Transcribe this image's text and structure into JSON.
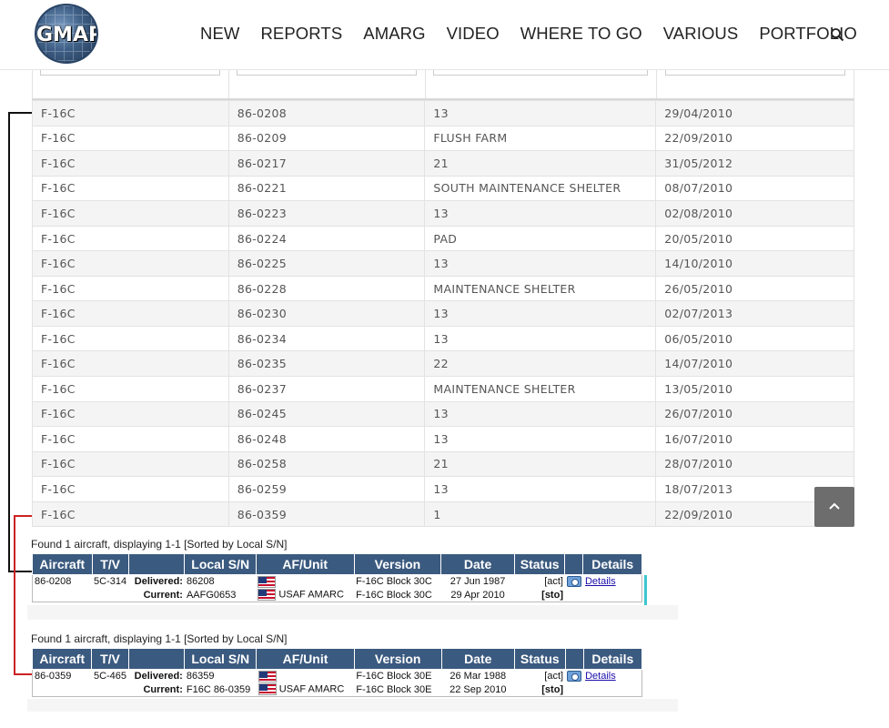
{
  "header": {
    "logo_text": "GMAP",
    "nav": [
      "NEW",
      "REPORTS",
      "AMARG",
      "VIDEO",
      "WHERE TO GO",
      "VARIOUS",
      "PORTFOLIO"
    ]
  },
  "table": {
    "rows": [
      [
        "F-16C",
        "86-0208",
        "13",
        "29/04/2010"
      ],
      [
        "F-16C",
        "86-0209",
        "FLUSH FARM",
        "22/09/2010"
      ],
      [
        "F-16C",
        "86-0217",
        "21",
        "31/05/2012"
      ],
      [
        "F-16C",
        "86-0221",
        "SOUTH MAINTENANCE SHELTER",
        "08/07/2010"
      ],
      [
        "F-16C",
        "86-0223",
        "13",
        "02/08/2010"
      ],
      [
        "F-16C",
        "86-0224",
        "PAD",
        "20/05/2010"
      ],
      [
        "F-16C",
        "86-0225",
        "13",
        "14/10/2010"
      ],
      [
        "F-16C",
        "86-0228",
        "MAINTENANCE SHELTER",
        "26/05/2010"
      ],
      [
        "F-16C",
        "86-0230",
        "13",
        "02/07/2013"
      ],
      [
        "F-16C",
        "86-0234",
        "13",
        "06/05/2010"
      ],
      [
        "F-16C",
        "86-0235",
        "22",
        "14/07/2010"
      ],
      [
        "F-16C",
        "86-0237",
        "MAINTENANCE SHELTER",
        "13/05/2010"
      ],
      [
        "F-16C",
        "86-0245",
        "13",
        "26/07/2010"
      ],
      [
        "F-16C",
        "86-0248",
        "13",
        "16/07/2010"
      ],
      [
        "F-16C",
        "86-0258",
        "21",
        "28/07/2010"
      ],
      [
        "F-16C",
        "86-0259",
        "13",
        "18/07/2013"
      ],
      [
        "F-16C",
        "86-0359",
        "1",
        "22/09/2010"
      ]
    ]
  },
  "panels": [
    {
      "found": "Found 1 aircraft, displaying 1-1 [Sorted by Local S/N]",
      "headers": [
        "Aircraft",
        "T/V",
        "",
        "Local S/N",
        "AF/Unit",
        "Version",
        "Date",
        "Status",
        "",
        "Details"
      ],
      "aircraft": "86-0208",
      "tv": "5C-314",
      "delivered_label": "Delivered:",
      "current_label": "Current:",
      "delivered_local": "86208",
      "current_local": "AAFG0653",
      "current_unit": "USAF AMARC",
      "delivered_version": "F-16C Block 30C",
      "current_version": "F-16C Block 30C",
      "delivered_date": "27 Jun 1987",
      "current_date": "29 Apr 2010",
      "delivered_status": "[act]",
      "current_status": "[sto]",
      "details_link": "Details"
    },
    {
      "found": "Found 1 aircraft, displaying 1-1 [Sorted by Local S/N]",
      "headers": [
        "Aircraft",
        "T/V",
        "",
        "Local S/N",
        "AF/Unit",
        "Version",
        "Date",
        "Status",
        "",
        "Details"
      ],
      "aircraft": "86-0359",
      "tv": "5C-465",
      "delivered_label": "Delivered:",
      "current_label": "Current:",
      "delivered_local": "86359",
      "current_local": "F16C 86-0359",
      "current_unit": "USAF AMARC",
      "delivered_version": "F-16C Block 30E",
      "current_version": "F-16C Block 30E",
      "delivered_date": "26 Mar 1988",
      "current_date": "22 Sep 2010",
      "delivered_status": "[act]",
      "current_status": "[sto]",
      "details_link": "Details"
    }
  ],
  "colors": {
    "header_blue": "#3b5a7f",
    "connector_black": "#111111",
    "connector_red": "#cc2222",
    "accent_cyan": "#3cc6cf"
  }
}
